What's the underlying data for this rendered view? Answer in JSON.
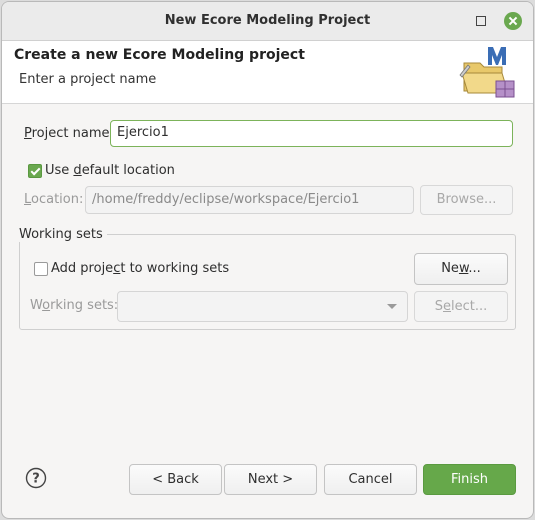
{
  "window": {
    "title": "New Ecore Modeling Project"
  },
  "banner": {
    "title": "Create a new Ecore Modeling project",
    "message": "Enter a project name",
    "icon": "ecore-wizard-icon"
  },
  "project_name": {
    "label_prefix": "P",
    "label_rest": "roject name:",
    "value": "Ejercio1"
  },
  "default_location": {
    "label_pre": "Use ",
    "label_u": "d",
    "label_post": "efault location",
    "checked": true
  },
  "location": {
    "label_u": "L",
    "label_rest": "ocation:",
    "value": "/home/freddy/eclipse/workspace/Ejercio1",
    "browse_label": "Browse..."
  },
  "working_sets": {
    "group_label": "Working sets",
    "add_label_pre": "Add proje",
    "add_label_u": "c",
    "add_label_post": "t to working sets",
    "add_checked": false,
    "new_label_pre": "Ne",
    "new_label_u": "w",
    "new_label_post": "...",
    "sets_label_pre": "W",
    "sets_label_u": "o",
    "sets_label_post": "rking sets:",
    "select_label_pre": "S",
    "select_label_u": "e",
    "select_label_post": "lect..."
  },
  "footer": {
    "back_label": "< Back",
    "next_label": "Next >",
    "cancel_label": "Cancel",
    "finish_label": "Finish"
  },
  "colors": {
    "accent": "#66a84a",
    "window_bg": "#f6f5f4"
  }
}
